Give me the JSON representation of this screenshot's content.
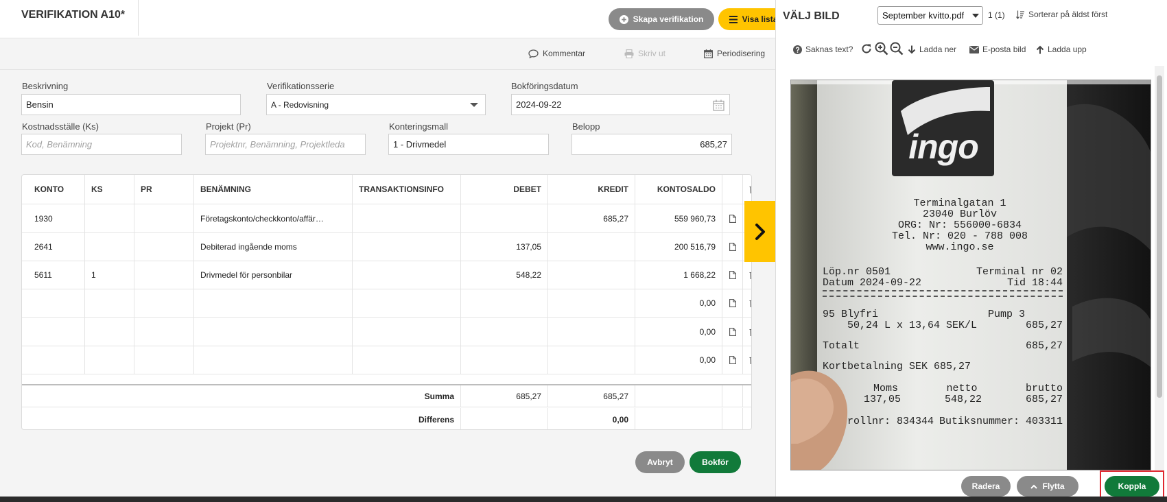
{
  "header": {
    "title": "VERIFIKATION A10*",
    "create_label": "Skapa verifikation",
    "list_label": "Visa lista"
  },
  "toolbar": {
    "comment": "Kommentar",
    "print": "Skriv ut",
    "period": "Periodisering"
  },
  "form": {
    "beskrivning_label": "Beskrivning",
    "beskrivning_value": "Bensin",
    "serie_label": "Verifikationsserie",
    "serie_value": "A - Redovisning",
    "datum_label": "Bokföringsdatum",
    "datum_value": "2024-09-22",
    "ks_label": "Kostnadsställe (Ks)",
    "ks_placeholder": "Kod, Benämning",
    "pr_label": "Projekt (Pr)",
    "pr_placeholder": "Projektnr, Benämning, Projektleda",
    "mall_label": "Konteringsmall",
    "mall_value": "1 - Drivmedel",
    "belopp_label": "Belopp",
    "belopp_value": "685,27"
  },
  "table": {
    "headers": [
      "KONTO",
      "KS",
      "PR",
      "BENÄMNING",
      "TRANSAKTIONSINFO",
      "DEBET",
      "KREDIT",
      "KONTOSALDO"
    ],
    "rows": [
      {
        "konto": "1930",
        "ks": "",
        "pr": "",
        "benamning": "Företagskonto/checkkonto/affär…",
        "info": "",
        "debet": "",
        "kredit": "685,27",
        "saldo": "559 960,73"
      },
      {
        "konto": "2641",
        "ks": "",
        "pr": "",
        "benamning": "Debiterad ingående moms",
        "info": "",
        "debet": "137,05",
        "kredit": "",
        "saldo": "200 516,79"
      },
      {
        "konto": "5611",
        "ks": "1",
        "pr": "",
        "benamning": "Drivmedel för personbilar",
        "info": "",
        "debet": "548,22",
        "kredit": "",
        "saldo": "1 668,22"
      },
      {
        "konto": "",
        "ks": "",
        "pr": "",
        "benamning": "",
        "info": "",
        "debet": "",
        "kredit": "",
        "saldo": "0,00"
      },
      {
        "konto": "",
        "ks": "",
        "pr": "",
        "benamning": "",
        "info": "",
        "debet": "",
        "kredit": "",
        "saldo": "0,00"
      },
      {
        "konto": "",
        "ks": "",
        "pr": "",
        "benamning": "",
        "info": "",
        "debet": "",
        "kredit": "",
        "saldo": "0,00"
      }
    ],
    "summa_label": "Summa",
    "summa_debet": "685,27",
    "summa_kredit": "685,27",
    "diff_label": "Differens",
    "diff_value": "0,00"
  },
  "footer": {
    "cancel": "Avbryt",
    "book": "Bokför"
  },
  "panel": {
    "title": "VÄLJ BILD",
    "file_select": "September kvitto.pdf",
    "page_count": "1 (1)",
    "sort_label": "Sorterar på äldst först",
    "missing_text": "Saknas text?",
    "download": "Ladda ner",
    "email": "E-posta bild",
    "upload": "Ladda upp",
    "delete": "Radera",
    "move": "Flytta",
    "link": "Koppla"
  },
  "receipt": {
    "brand": "ingo",
    "lines": [
      "Terminalgatan 1",
      "23040 Burlöv",
      "ORG: Nr: 556000-6834",
      "Tel. Nr: 020 - 788 008",
      "www.ingo.se"
    ],
    "lop_label": "Löp.nr 0501",
    "terminal_label": "Terminal nr 02",
    "datum_label": "Datum 2024-09-22",
    "tid_label": "Tid 18:44",
    "fuel": "95 Blyfri",
    "pump": "Pump 3",
    "fuel_calc": "50,24 L  x  13,64 SEK/L",
    "fuel_amount": "685,27",
    "total_label": "Totalt",
    "total_amount": "685,27",
    "card": "Kortbetalning SEK 685,27",
    "moms_h": "Moms",
    "netto_h": "netto",
    "brutto_h": "brutto",
    "moms_v": "137,05",
    "netto_v": "548,22",
    "brutto_v": "685,27",
    "kontroll": "Kontrollnr: 834344",
    "butik": "Butiksnummer: 403311"
  },
  "colors": {
    "accent_yellow": "#ffc400",
    "primary_green": "#117a3a",
    "grey_button": "#8a8a8a",
    "highlight_red": "#e0262f"
  }
}
